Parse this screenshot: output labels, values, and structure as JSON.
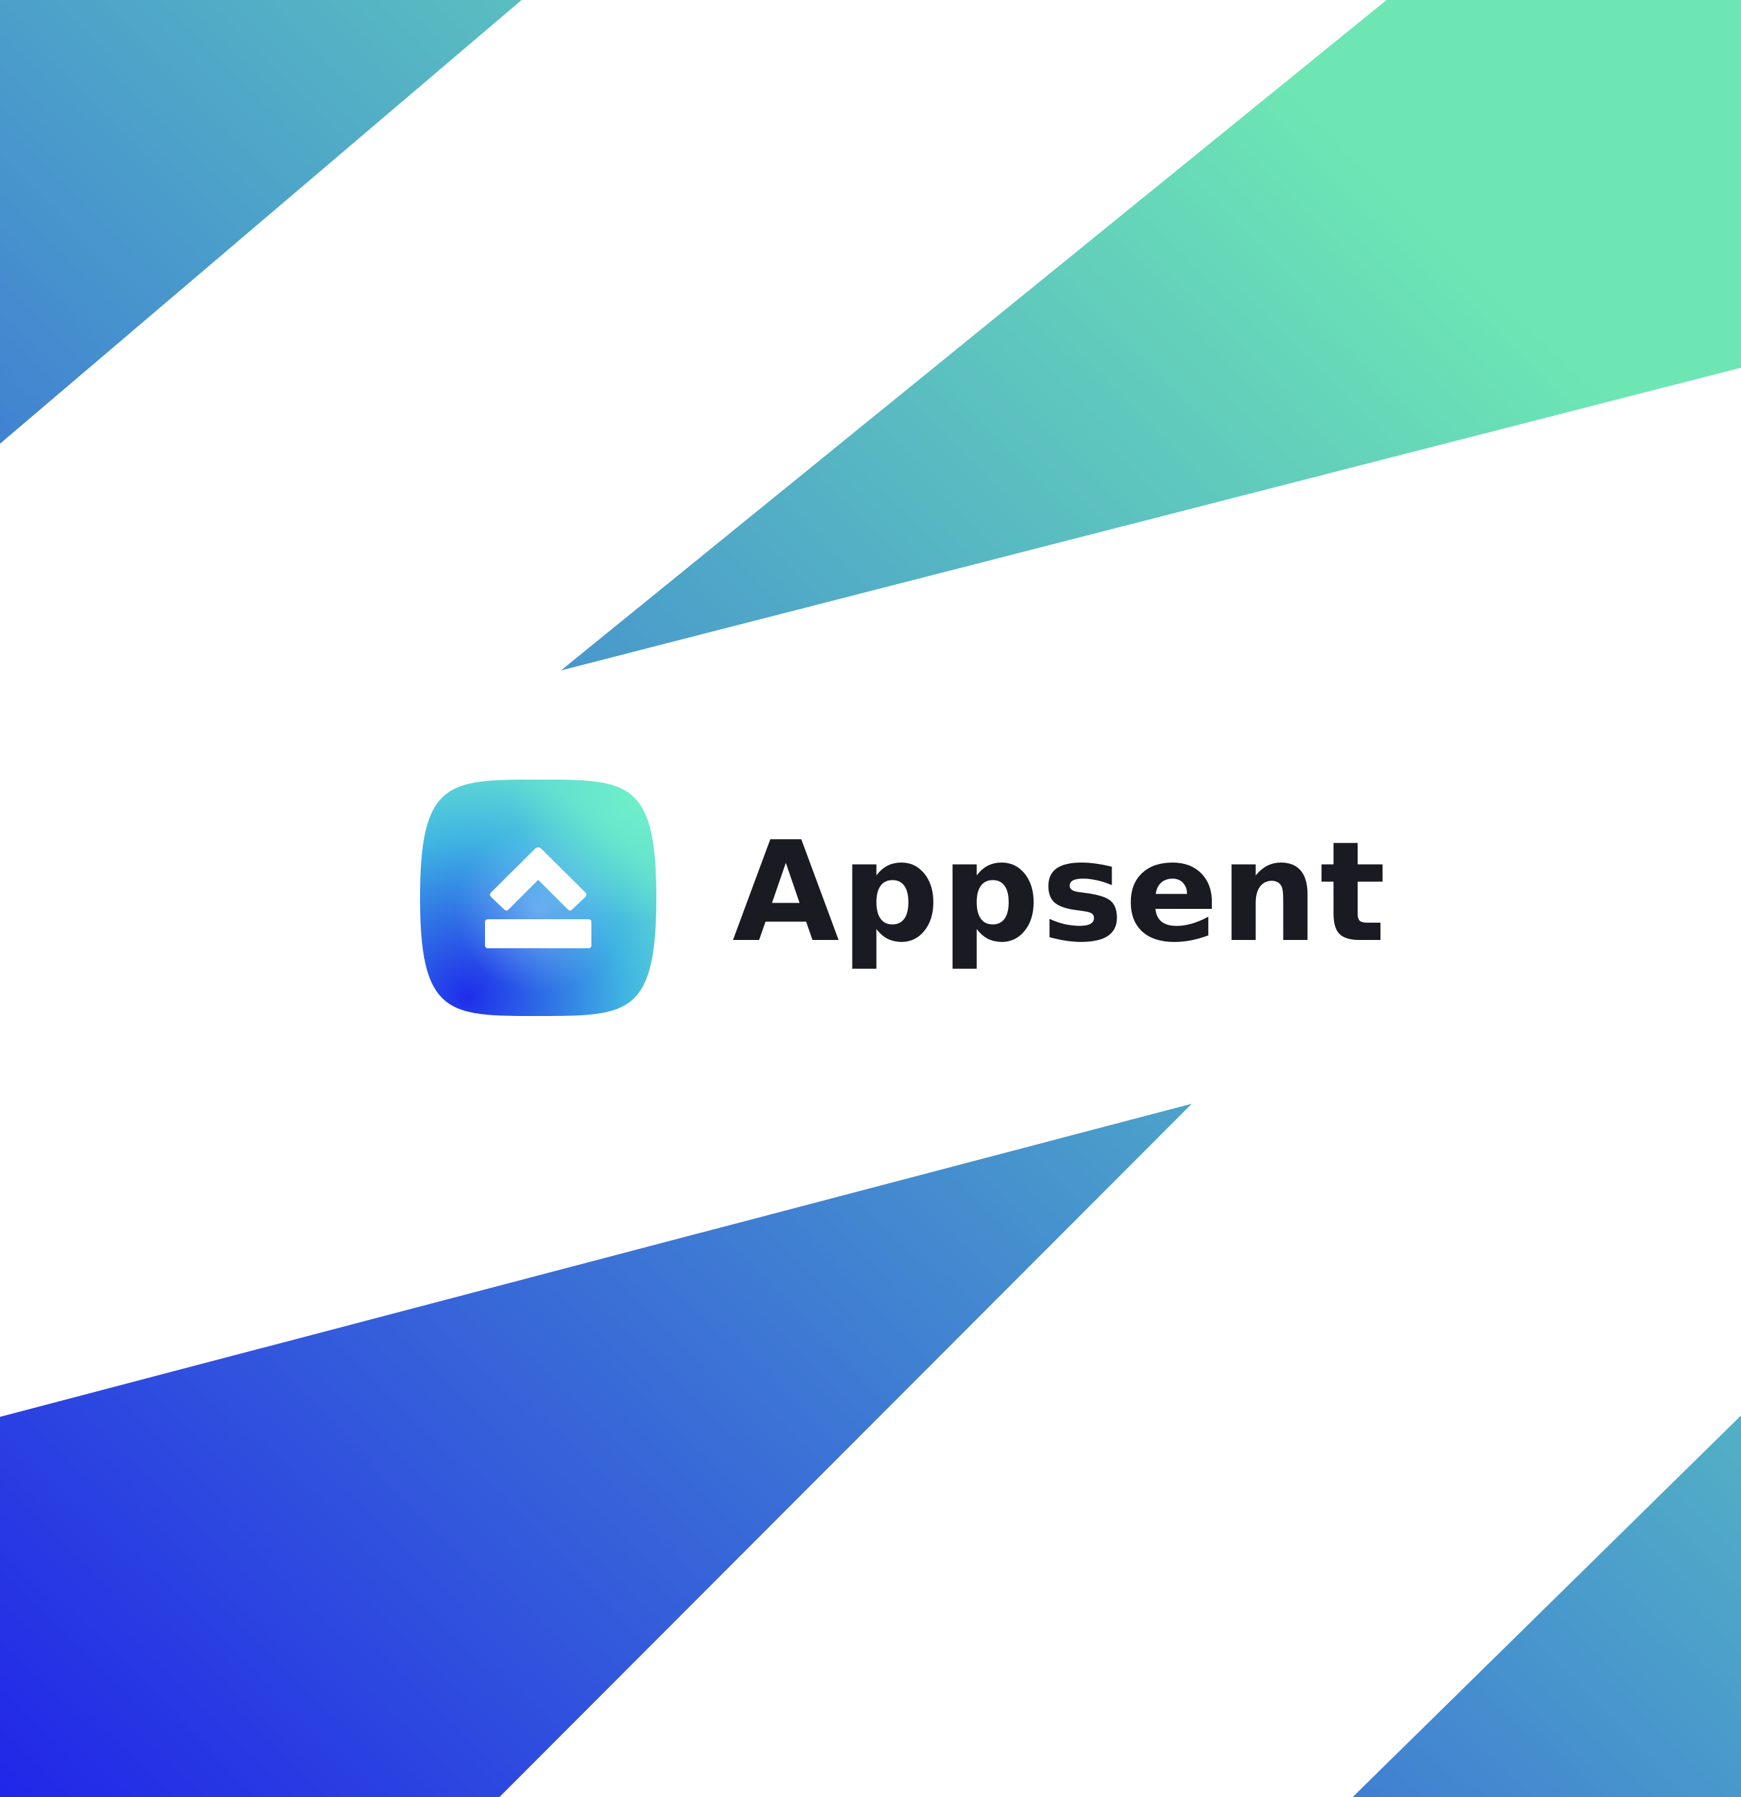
{
  "brand": {
    "name": "Appsent",
    "icon": "eject-up-arrow-icon"
  },
  "colors": {
    "background": "#ffffff",
    "wordmark": "#1a1a22",
    "gradient_blue": "#2126e8",
    "gradient_mid": "#4a9ccb",
    "gradient_green": "#6de6b4",
    "icon_glyph": "#ffffff"
  }
}
